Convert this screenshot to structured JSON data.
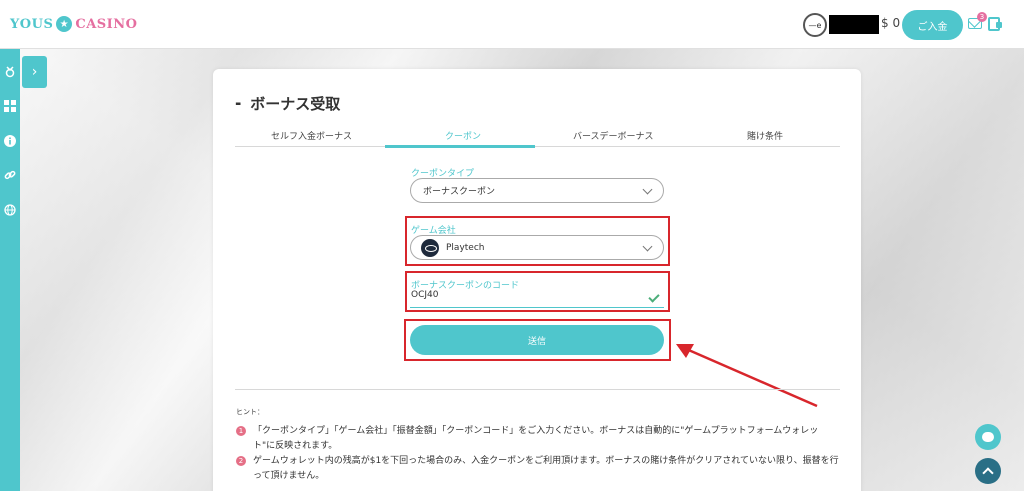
{
  "header": {
    "logo_left": "YOUS",
    "logo_star": "★",
    "logo_right": "CASINO",
    "avatar_text": "—e",
    "balance": "$ 0",
    "deposit_label": "ご入金",
    "mail_badge": "3"
  },
  "sidebar": {
    "toggle": "›",
    "icons": [
      "medal-icon",
      "grid-icon",
      "info-icon",
      "link-icon",
      "globe-icon"
    ]
  },
  "page": {
    "title": "ボーナス受取",
    "tabs": [
      {
        "label": "セルフ入金ボーナス"
      },
      {
        "label": "クーポン"
      },
      {
        "label": "バースデーボーナス"
      },
      {
        "label": "賭け条件"
      }
    ],
    "active_tab": "クーポン"
  },
  "form": {
    "coupon_type_label": "クーポンタイプ",
    "coupon_type_value": "ボーナスクーポン",
    "game_company_label": "ゲーム会社",
    "game_company_value": "Playtech",
    "code_label": "ボーナスクーポンのコード",
    "code_value": "OCJ40",
    "submit_label": "送信"
  },
  "hints": {
    "title": "ヒント：",
    "items": [
      {
        "num": "1",
        "text": "「クーポンタイプ」「ゲーム会社」「振替金額」「クーポンコード」をご入力ください。ボーナスは自動的に\"ゲームプラットフォームウォレット\"に反映されます。"
      },
      {
        "num": "2",
        "text": "ゲームウォレット内の残高が$1を下回った場合のみ、入金クーポンをご利用頂けます。ボーナスの賭け条件がクリアされていない限り、振替を行って頂けません。"
      }
    ]
  },
  "colors": {
    "accent": "#4fc6cc",
    "highlight_red": "#d8262c",
    "pink": "#e56fa0"
  }
}
